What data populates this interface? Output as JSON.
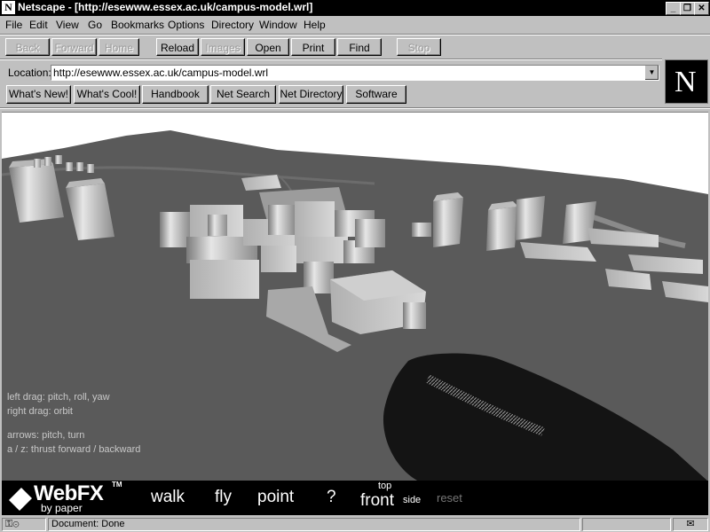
{
  "window": {
    "title": "Netscape - [http://esewww.essex.ac.uk/campus-model.wrl]",
    "app_icon": "netscape-icon",
    "controls": [
      "minimize-icon",
      "restore-icon",
      "close-icon"
    ]
  },
  "menu": [
    "File",
    "Edit",
    "View",
    "Go",
    "Bookmarks",
    "Options",
    "Directory",
    "Window",
    "Help"
  ],
  "toolbar": {
    "back": "Back",
    "forward": "Forward",
    "home": "Home",
    "reload": "Reload",
    "images": "Images",
    "open": "Open",
    "print": "Print",
    "find": "Find",
    "stop": "Stop"
  },
  "location": {
    "label": "Location:",
    "url": "http://esewww.essex.ac.uk/campus-model.wrl"
  },
  "directory_buttons": [
    "What's New!",
    "What's Cool!",
    "Handbook",
    "Net Search",
    "Net Directory",
    "Software"
  ],
  "logo": {
    "letter": "N"
  },
  "viewer": {
    "help": [
      "left drag: pitch, roll, yaw",
      "right drag: orbit",
      "arrows: pitch, turn",
      "a / z: thrust forward / backward"
    ]
  },
  "webfx": {
    "brand": "WebFX",
    "tm": "TM",
    "by": "by paper",
    "nav": {
      "walk": "walk",
      "fly": "fly",
      "point": "point",
      "help": "?",
      "top": "top",
      "front": "front",
      "side": "side",
      "reset": "reset"
    }
  },
  "status": {
    "text": "Document: Done",
    "icons": [
      "security-key-icon",
      "mail-icon"
    ]
  },
  "colors": {
    "ground": "#5a5a5a",
    "sky": "#ffffff",
    "chrome": "#c0c0c0",
    "titlebar": "#000000"
  }
}
